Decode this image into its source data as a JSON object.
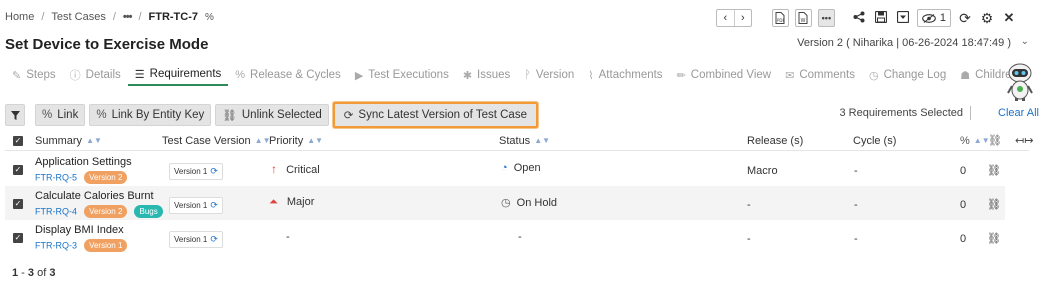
{
  "breadcrumb": {
    "home": "Home",
    "test_cases": "Test Cases",
    "ellipsis": "•••",
    "current": "FTR-TC-7",
    "current_icon": "link-icon"
  },
  "toolbar": {
    "prev": "‹",
    "next": "›",
    "watch_count": "1"
  },
  "page": {
    "title": "Set Device to Exercise Mode",
    "version_info": "Version 2 ( Niharika | 06-26-2024 18:47:49 )"
  },
  "tabs": [
    {
      "label": "Steps",
      "icon": "edit-icon"
    },
    {
      "label": "Details",
      "icon": "info-icon"
    },
    {
      "label": "Requirements",
      "icon": "list-icon",
      "active": true
    },
    {
      "label": "Release & Cycles",
      "icon": "link-icon"
    },
    {
      "label": "Test Executions",
      "icon": "play-icon"
    },
    {
      "label": "Issues",
      "icon": "bug-icon"
    },
    {
      "label": "Version",
      "icon": "branch-icon"
    },
    {
      "label": "Attachments",
      "icon": "paperclip-icon"
    },
    {
      "label": "Combined View",
      "icon": "pencil-icon"
    },
    {
      "label": "Comments",
      "icon": "comments-icon"
    },
    {
      "label": "Change Log",
      "icon": "clock-icon"
    },
    {
      "label": "Children",
      "icon": "sitemap-icon"
    }
  ],
  "actions": {
    "link": "Link",
    "link_by_entity_key": "Link By Entity Key",
    "unlink_selected": "Unlink Selected",
    "sync_latest": "Sync Latest Version of Test Case"
  },
  "selection": {
    "summary": "3 Requirements Selected",
    "clear_all": "Clear All"
  },
  "table": {
    "headers": {
      "summary": "Summary",
      "test_case_version": "Test Case Version",
      "priority": "Priority",
      "status": "Status",
      "release": "Release (s)",
      "cycle": "Cycle (s)"
    },
    "rows": [
      {
        "summary": "Application Settings",
        "id": "FTR-RQ-5",
        "version_badge": "Version 2",
        "extra_badge": "",
        "tc_version": "Version 1",
        "priority": "Critical",
        "priority_icon": "arrow-up-icon",
        "status": "Open",
        "status_icon": "open-circle-icon",
        "release": "Macro",
        "cycle": "-",
        "count": "0"
      },
      {
        "summary": "Calculate Calories Burnt",
        "id": "FTR-RQ-4",
        "version_badge": "Version 2",
        "extra_badge": "Bugs",
        "tc_version": "Version 1",
        "priority": "Major",
        "priority_icon": "double-chevron-up-icon",
        "status": "On Hold",
        "status_icon": "clock-icon",
        "release": "-",
        "cycle": "-",
        "count": "0"
      },
      {
        "summary": "Display BMI Index",
        "id": "FTR-RQ-3",
        "version_badge": "Version 1",
        "extra_badge": "",
        "tc_version": "Version 1",
        "priority": "-",
        "priority_icon": "",
        "status": "-",
        "status_icon": "",
        "release": "-",
        "cycle": "-",
        "count": "0"
      }
    ]
  },
  "pagination": {
    "range_start": "1",
    "range_sep": " - ",
    "range_end": "3",
    "of": " of ",
    "total": "3"
  },
  "colors": {
    "accent_green": "#2e8b57",
    "link_blue": "#1a73c9",
    "highlight_orange": "#f29a38",
    "badge_orange": "#f0a060",
    "badge_teal": "#28b8b0",
    "critical_red": "#e04040"
  }
}
